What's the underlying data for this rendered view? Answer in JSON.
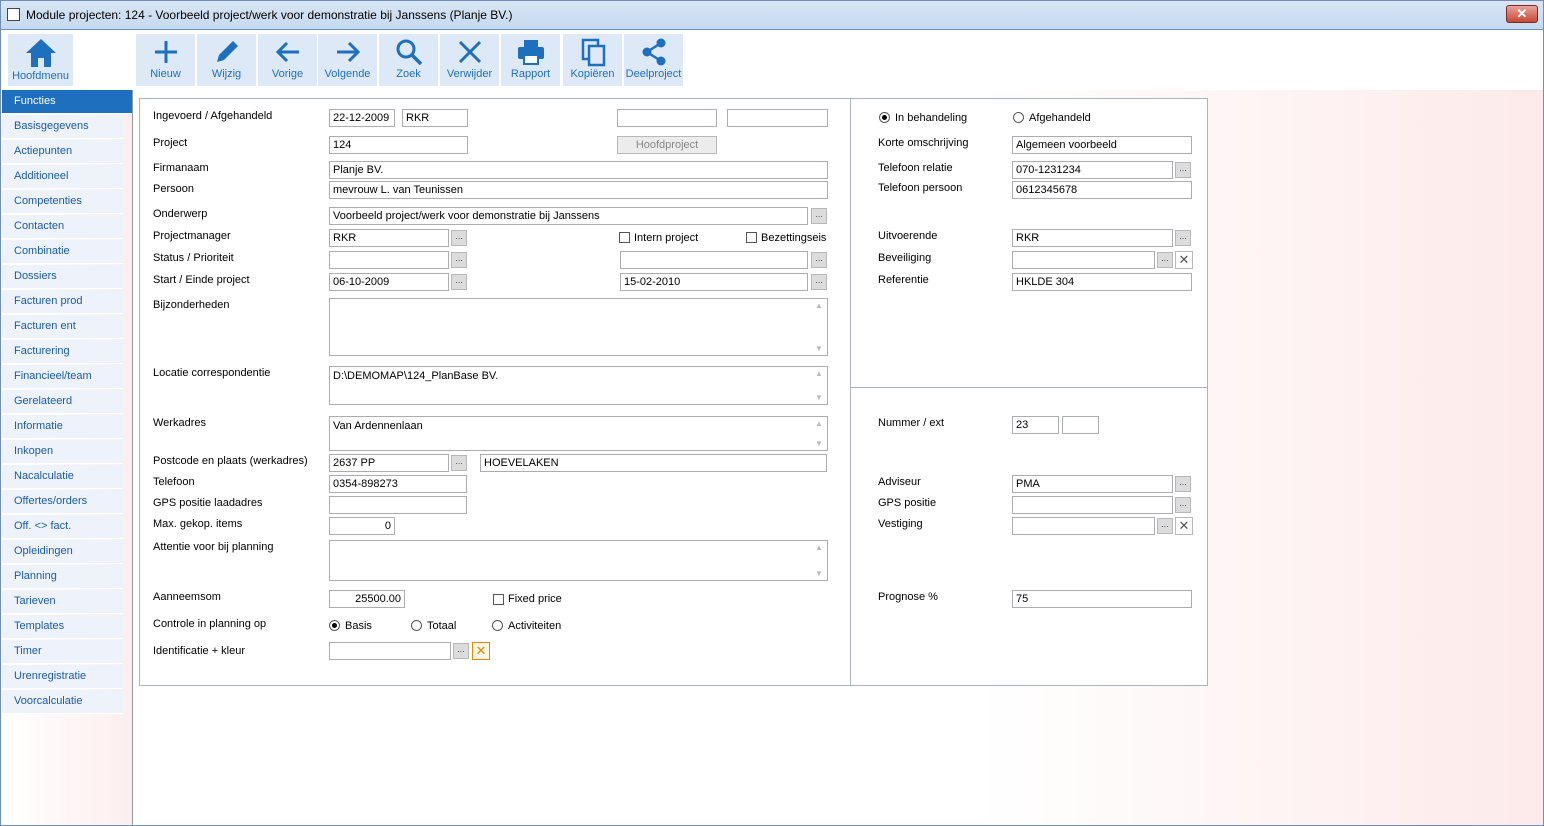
{
  "window": {
    "title": "Module projecten: 124 - Voorbeeld project/werk voor demonstratie bij Janssens (Planje BV.)",
    "close": "✕"
  },
  "toolbar": {
    "home": "Hoofdmenu",
    "new": "Nieuw",
    "edit": "Wijzig",
    "prev": "Vorige",
    "next": "Volgende",
    "search": "Zoek",
    "delete": "Verwijder",
    "report": "Rapport",
    "copy": "Kopiëren",
    "subproject": "Deelproject"
  },
  "sidebar": {
    "items": [
      "Functies",
      "Basisgegevens",
      "Actiepunten",
      "Additioneel",
      "Competenties",
      "Contacten",
      "Combinatie",
      "Dossiers",
      "Facturen prod",
      "Facturen ent",
      "Facturering",
      "Financieel/team",
      "Gerelateerd",
      "Informatie",
      "Inkopen",
      "Nacalculatie",
      "Offertes/orders",
      "Off. <> fact.",
      "Opleidingen",
      "Planning",
      "Tarieven",
      "Templates",
      "Timer",
      "Urenregistratie",
      "Voorcalculatie"
    ]
  },
  "form": {
    "ingevoerd_label": "Ingevoerd / Afgehandeld",
    "ingevoerd_date": "22-12-2009",
    "ingevoerd_user": "RKR",
    "project_label": "Project",
    "project": "124",
    "hoofdproject": "Hoofdproject",
    "firma_label": "Firmanaam",
    "firma": "Planje BV.",
    "persoon_label": "Persoon",
    "persoon": "mevrouw L. van Teunissen",
    "onderwerp_label": "Onderwerp",
    "onderwerp": "Voorbeeld project/werk voor demonstratie bij Janssens",
    "pm_label": "Projectmanager",
    "pm": "RKR",
    "intern_label": "Intern project",
    "bezetting_label": "Bezettingseis",
    "status_label": "Status / Prioriteit",
    "start_label": "Start / Einde project",
    "start": "06-10-2009",
    "einde": "15-02-2010",
    "bijz_label": "Bijzonderheden",
    "locatie_label": "Locatie correspondentie",
    "locatie": "D:\\DEMOMAP\\124_PlanBase BV.",
    "werkadres_label": "Werkadres",
    "werkadres": "Van Ardennenlaan",
    "postcode_label": "Postcode en plaats (werkadres)",
    "postcode": "2637 PP",
    "plaats": "HOEVELAKEN",
    "telefoon_label": "Telefoon",
    "telefoon": "0354-898273",
    "gps_label": "GPS positie laadadres",
    "max_label": "Max. gekop. items",
    "max": "0",
    "attentie_label": "Attentie voor bij planning",
    "aanneem_label": "Aanneemsom",
    "aanneem": "25500.00",
    "fixed_label": "Fixed price",
    "controle_label": "Controle in planning op",
    "basis": "Basis",
    "totaal": "Totaal",
    "activiteiten": "Activiteiten",
    "ident_label": "Identificatie + kleur"
  },
  "right": {
    "in_behandeling": "In behandeling",
    "afgehandeld": "Afgehandeld",
    "korte_label": "Korte omschrijving",
    "korte": "Algemeen voorbeeld",
    "tel_rel_label": "Telefoon relatie",
    "tel_rel": "070-1231234",
    "tel_pers_label": "Telefoon persoon",
    "tel_pers": "0612345678",
    "uitv_label": "Uitvoerende",
    "uitv": "RKR",
    "beveiliging_label": "Beveiliging",
    "referentie_label": "Referentie",
    "referentie": "HKLDE 304",
    "nummer_label": "Nummer / ext",
    "nummer": "23",
    "adviseur_label": "Adviseur",
    "adviseur": "PMA",
    "gps_label": "GPS positie",
    "vestiging_label": "Vestiging",
    "prognose_label": "Prognose %",
    "prognose": "75"
  },
  "icons": {
    "dots": "...",
    "clear": "✕",
    "up": "▲",
    "down": "▼"
  },
  "colors": {
    "accent": "#1e6fbd",
    "toolbar_bg": "#dde9f6"
  }
}
